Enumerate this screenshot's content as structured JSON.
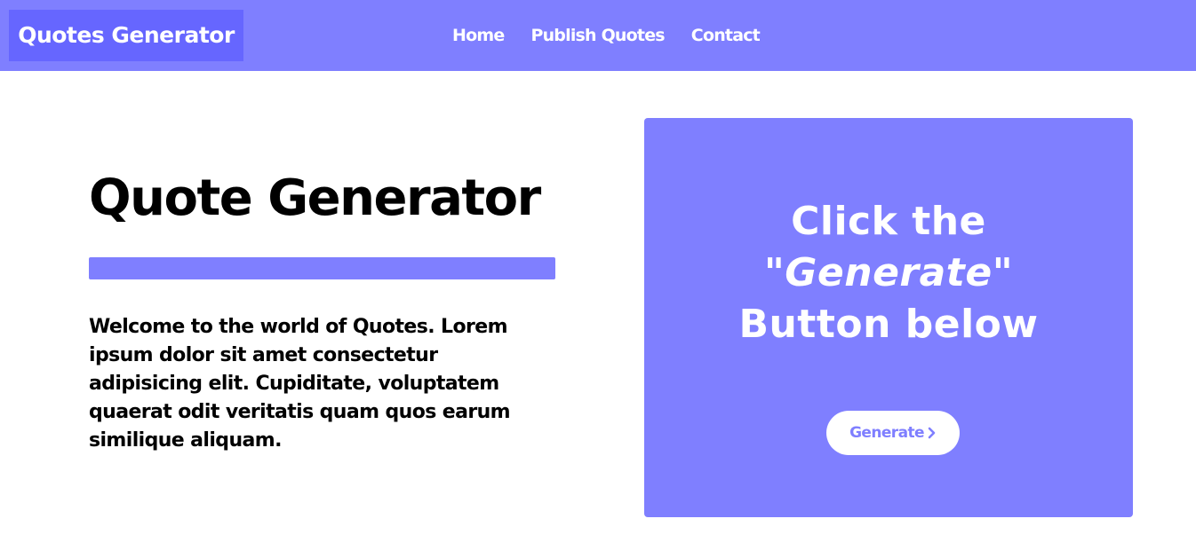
{
  "navbar": {
    "brand": "Quotes Generator",
    "links": [
      "Home",
      "Publish Quotes",
      "Contact"
    ]
  },
  "hero": {
    "title": "Quote Generator",
    "intro": "Welcome to the world of Quotes. Lorem ipsum dolor sit amet consectetur adipisicing elit. Cupiditate, voluptatem quaerat odit veritatis quam quos earum similique aliquam."
  },
  "card": {
    "line1": "Click the",
    "quote_open": "\"",
    "emphasis": "Generate",
    "quote_close": "\"",
    "line3": "Button below",
    "button_label": "Generate",
    "button_icon": "chevron-right-icon"
  },
  "colors": {
    "accent": "#7f7fff",
    "brand_bg": "#6666ff",
    "text": "#000000",
    "on_accent": "#ffffff"
  }
}
